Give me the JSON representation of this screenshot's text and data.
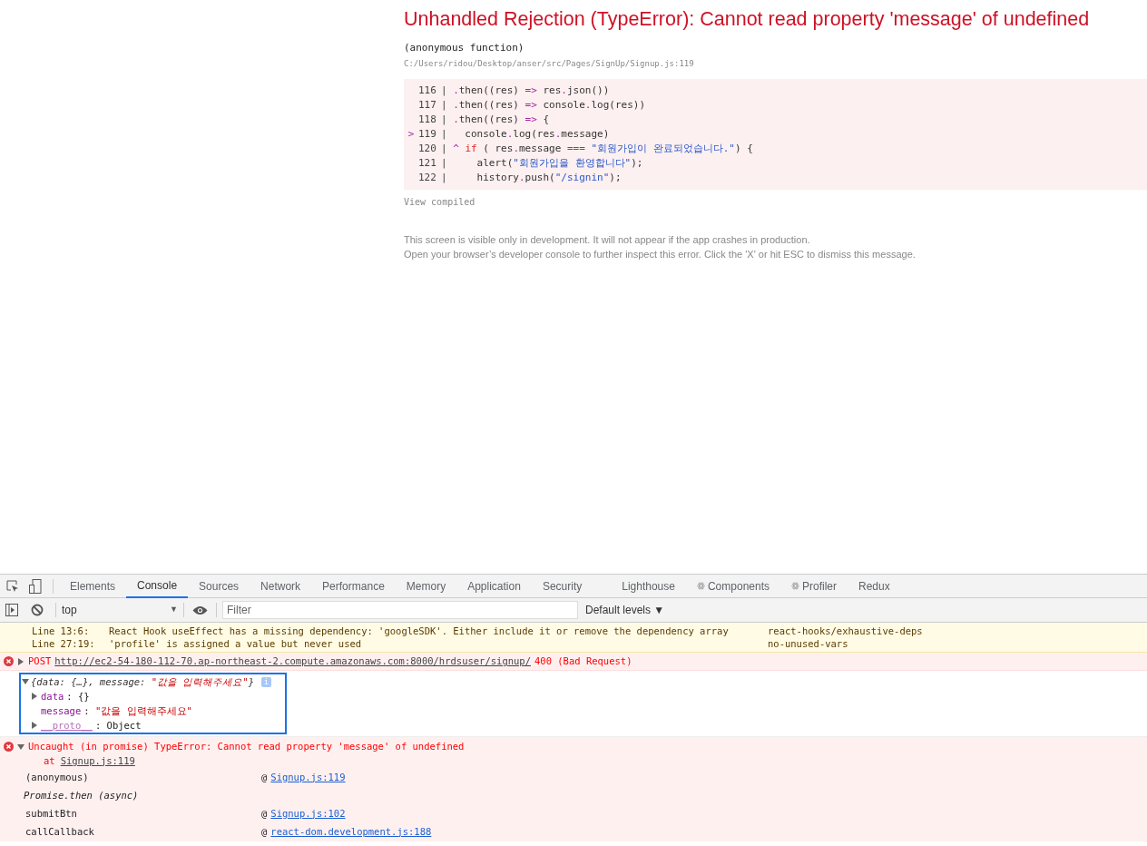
{
  "error_overlay": {
    "title": "Unhandled Rejection (TypeError): Cannot read property 'message' of undefined",
    "frame_function": "(anonymous function)",
    "frame_file": "C:/Users/ridou/Desktop/anser/src/Pages/SignUp/Signup.js:119",
    "code_lines": [
      {
        "number": "116",
        "gutter": "|",
        "segments": [
          {
            "kind": "op",
            "text": "."
          },
          {
            "kind": "plain",
            "text": "then((res) "
          },
          {
            "kind": "op",
            "text": "=>"
          },
          {
            "kind": "plain",
            "text": " res"
          },
          {
            "kind": "op",
            "text": "."
          },
          {
            "kind": "plain",
            "text": "json())"
          }
        ]
      },
      {
        "number": "117",
        "gutter": "|",
        "segments": [
          {
            "kind": "op",
            "text": "."
          },
          {
            "kind": "plain",
            "text": "then((res) "
          },
          {
            "kind": "op",
            "text": "=>"
          },
          {
            "kind": "plain",
            "text": " console"
          },
          {
            "kind": "op",
            "text": "."
          },
          {
            "kind": "plain",
            "text": "log(res))"
          }
        ]
      },
      {
        "number": "118",
        "gutter": "|",
        "segments": [
          {
            "kind": "op",
            "text": "."
          },
          {
            "kind": "plain",
            "text": "then((res) "
          },
          {
            "kind": "op",
            "text": "=>"
          },
          {
            "kind": "plain",
            "text": " {"
          }
        ]
      },
      {
        "number": "119",
        "gutter": "|",
        "marker": ">",
        "segments": [
          {
            "kind": "plain",
            "text": "  console"
          },
          {
            "kind": "op",
            "text": "."
          },
          {
            "kind": "plain",
            "text": "log(res"
          },
          {
            "kind": "op",
            "text": "."
          },
          {
            "kind": "plain",
            "text": "message)"
          }
        ]
      },
      {
        "number": "120",
        "gutter": "|",
        "caret": "^",
        "segments": [
          {
            "kind": "keyword",
            "text": "if"
          },
          {
            "kind": "plain",
            "text": " ( res"
          },
          {
            "kind": "op",
            "text": "."
          },
          {
            "kind": "plain",
            "text": "message "
          },
          {
            "kind": "op",
            "text": "==="
          },
          {
            "kind": "string",
            "text": " \"회원가입이 완료되었습니다.\""
          },
          {
            "kind": "plain",
            "text": ") {"
          }
        ]
      },
      {
        "number": "121",
        "gutter": "|",
        "segments": [
          {
            "kind": "plain",
            "text": "    alert("
          },
          {
            "kind": "string",
            "text": "\"회원가입을 환영합니다\""
          },
          {
            "kind": "plain",
            "text": ");"
          }
        ]
      },
      {
        "number": "122",
        "gutter": "|",
        "segments": [
          {
            "kind": "plain",
            "text": "    history"
          },
          {
            "kind": "op",
            "text": "."
          },
          {
            "kind": "plain",
            "text": "push("
          },
          {
            "kind": "string",
            "text": "\"/signin\""
          },
          {
            "kind": "plain",
            "text": ");"
          }
        ]
      }
    ],
    "view_compiled": "View compiled",
    "notes": [
      "This screen is visible only in development. It will not appear if the app crashes in production.",
      "Open your browser’s developer console to further inspect this error.  Click the 'X' or hit ESC to dismiss this message."
    ]
  },
  "devtools": {
    "tabs": [
      {
        "label": "Elements",
        "selected": false,
        "react": false
      },
      {
        "label": "Console",
        "selected": true,
        "react": false
      },
      {
        "label": "Sources",
        "selected": false,
        "react": false
      },
      {
        "label": "Network",
        "selected": false,
        "react": false
      },
      {
        "label": "Performance",
        "selected": false,
        "react": false
      },
      {
        "label": "Memory",
        "selected": false,
        "react": false
      },
      {
        "label": "Application",
        "selected": false,
        "react": false
      },
      {
        "label": "Security",
        "selected": false,
        "react": false
      },
      {
        "label": "Lighthouse",
        "selected": false,
        "react": false
      },
      {
        "label": "Components",
        "selected": false,
        "react": true
      },
      {
        "label": "Profiler",
        "selected": false,
        "react": true
      },
      {
        "label": "Redux",
        "selected": false,
        "react": false
      }
    ],
    "context": "top",
    "filter_placeholder": "Filter",
    "levels": "Default levels ▼",
    "context_caret": "▼",
    "warnings": [
      {
        "location": "Line 13:6:",
        "message": "React Hook useEffect has a missing dependency: 'googleSDK'. Either include it or remove the dependency array",
        "rule": "react-hooks/exhaustive-deps"
      },
      {
        "location": "Line 27:19:",
        "message": "'profile' is assigned a value but never used",
        "rule": "no-unused-vars"
      }
    ],
    "request_error": {
      "method": "POST",
      "url": "http://ec2-54-180-112-70.ap-northeast-2.compute.amazonaws.com:8000/hrdsuser/signup/",
      "status": "400 (Bad Request)",
      "expanded": false
    },
    "object_log": {
      "summary_prefix": "{data: {…}, message: ",
      "summary_value": "\"값을 입력해주세요\"",
      "summary_suffix": "}",
      "info_badge": "i",
      "expanded": true,
      "separator": ":",
      "properties": [
        {
          "key": "data",
          "value": "{}",
          "expandable": true,
          "kind": "object"
        },
        {
          "key": "message",
          "value": "\"값을 입력해주세요\"",
          "expandable": false,
          "kind": "string"
        },
        {
          "key": "__proto__",
          "value": "Object",
          "expandable": true,
          "kind": "object"
        }
      ]
    },
    "uncaught_error": {
      "message": "Uncaught (in promise) TypeError: Cannot read property 'message' of undefined",
      "at": "at",
      "at_link": "Signup.js:119",
      "expanded": true,
      "stack": [
        {
          "function": "(anonymous)",
          "link": "Signup.js:119",
          "async": false
        },
        {
          "function": "Promise.then (async)",
          "async": true
        },
        {
          "function": "submitBtn",
          "link": "Signup.js:102",
          "async": false
        },
        {
          "function": "callCallback",
          "link": "react-dom.development.js:188",
          "async": false
        }
      ],
      "at_sign": "@"
    }
  }
}
